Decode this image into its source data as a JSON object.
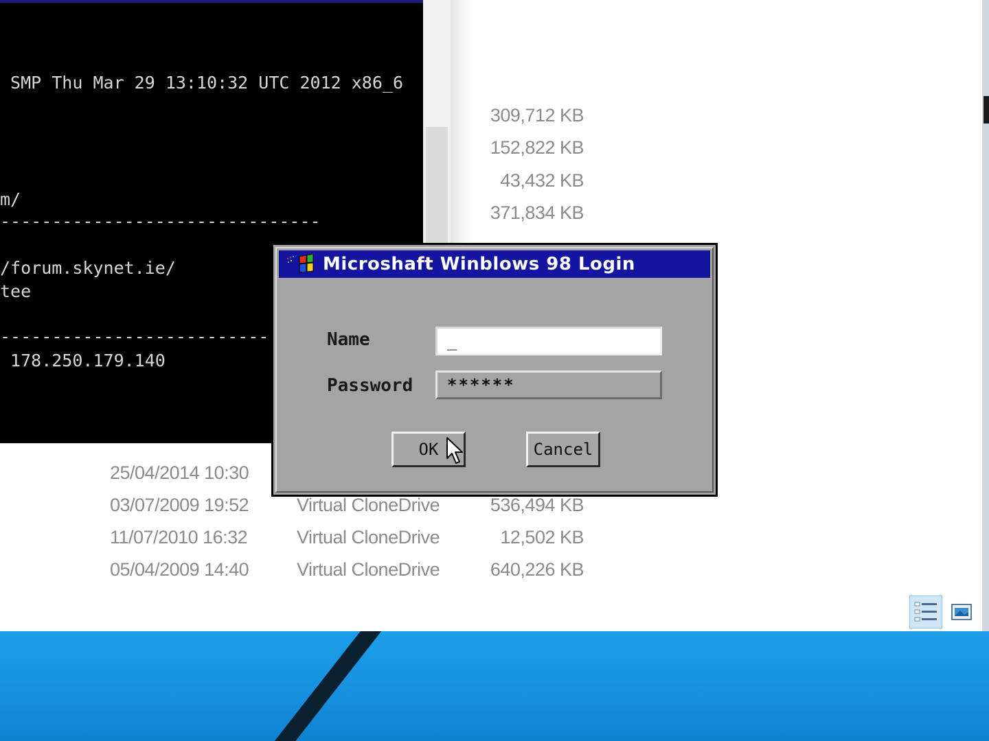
{
  "terminal": {
    "lines": [
      " SMP Thu Mar 29 13:10:32 UTC 2012 x86_6",
      "m/",
      "-------------------------------",
      "/forum.skynet.ie/",
      "tee",
      "--------------------------",
      " 178.250.179.140"
    ]
  },
  "explorer": {
    "sizes_top": [
      "309,712 KB",
      "152,822 KB",
      "43,432 KB",
      "371,834 KB"
    ],
    "rows": [
      {
        "date": "25/04/2014 10:30",
        "type": "",
        "size": ""
      },
      {
        "date": "03/07/2009 19:52",
        "type": "Virtual CloneDrive",
        "size": "536,494 KB"
      },
      {
        "date": "11/07/2010 16:32",
        "type": "Virtual CloneDrive",
        "size": "12,502 KB"
      },
      {
        "date": "05/04/2009 14:40",
        "type": "Virtual CloneDrive",
        "size": "640,226 KB"
      }
    ],
    "view_buttons": [
      "details-view-icon",
      "large-icons-view-icon"
    ]
  },
  "dialog": {
    "title": "Microshaft Winblows 98 Login",
    "name_label": "Name",
    "name_value": "_",
    "password_label": "Password",
    "password_value": "******",
    "ok_label": "OK",
    "cancel_label": "Cancel"
  },
  "colors": {
    "titlebar": "#1414a0",
    "dialog_bg": "#a4a4a4",
    "desktop": "#1a9be6",
    "terminal_bg": "#000000"
  }
}
